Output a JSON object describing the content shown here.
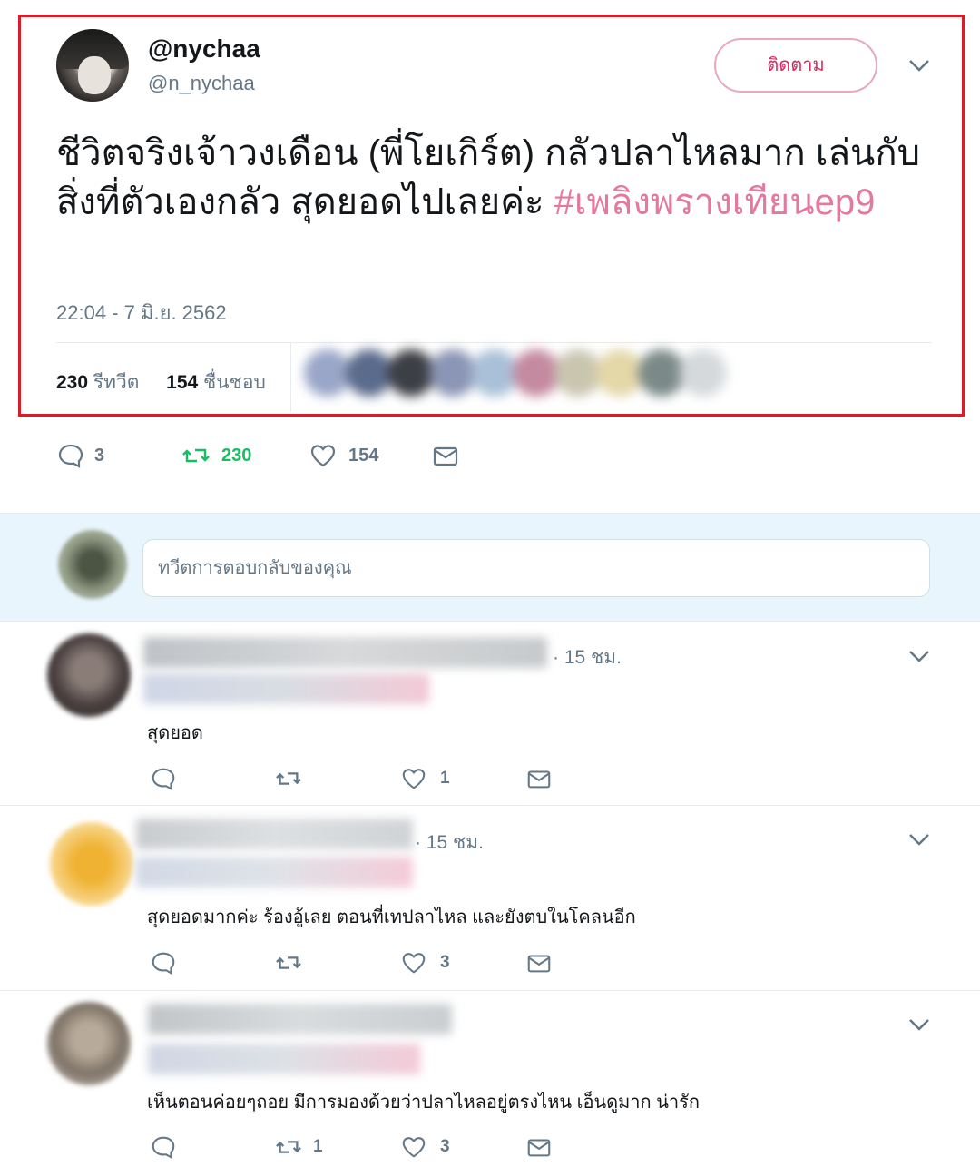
{
  "tweet": {
    "display_name": "@nychaa",
    "handle": "@n_nychaa",
    "follow_label": "ติดตาม",
    "text_main": "ชีวิตจริงเจ้าวงเดือน (พี่โยเกิร์ต) กลัวปลาไหลมาก เล่นกับสิ่งที่ตัวเองกลัว สุดยอดไปเลยค่ะ ",
    "hashtag": "#เพลิงพรางเทียนep9",
    "timestamp": "22:04 - 7 มิ.ย. 2562",
    "retweet_count": "230",
    "retweet_label": "รีทวีต",
    "like_count": "154",
    "like_label": "ชื่นชอบ"
  },
  "actions": {
    "reply_count": "3",
    "retweet_count": "230",
    "like_count": "154"
  },
  "reply_box": {
    "placeholder": "ทวีตการตอบกลับของคุณ"
  },
  "replies": [
    {
      "time": "· 15 ชม.",
      "text": "สุดยอด",
      "reply_count": "",
      "retweet_count": "",
      "like_count": "1"
    },
    {
      "time": "· 15 ชม.",
      "text": "สุดยอดมากค่ะ ร้องอู้เลย ตอนที่เทปลาไหล และยังตบในโคลนอีก",
      "reply_count": "",
      "retweet_count": "",
      "like_count": "3"
    },
    {
      "time": "",
      "text": "เห็นตอนค่อยๆถอย มีการมองด้วยว่าปลาไหลอยู่ตรงไหน เอ็นดูมาก น่ารัก",
      "reply_count": "",
      "retweet_count": "1",
      "like_count": "3"
    }
  ],
  "colors": {
    "highlight_border": "#d71e28",
    "hashtag": "#e4789f",
    "retweet_green": "#17bf63",
    "muted": "#657786"
  }
}
